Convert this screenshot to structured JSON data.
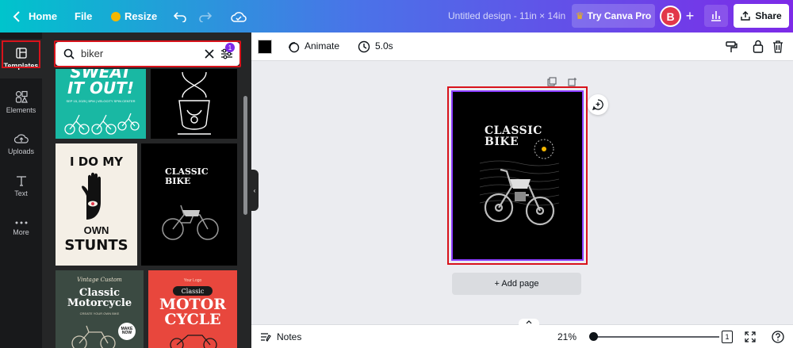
{
  "topbar": {
    "home_label": "Home",
    "file_label": "File",
    "resize_label": "Resize",
    "doc_title": "Untitled design - 11in × 14in",
    "try_pro_label": "Try Canva Pro",
    "avatar_initial": "B",
    "share_label": "Share"
  },
  "sidebar": {
    "items": [
      {
        "label": "Templates",
        "icon": "templates-icon"
      },
      {
        "label": "Elements",
        "icon": "elements-icon"
      },
      {
        "label": "Uploads",
        "icon": "uploads-icon"
      },
      {
        "label": "Text",
        "icon": "text-icon"
      },
      {
        "label": "More",
        "icon": "more-icon"
      }
    ]
  },
  "search": {
    "value": "biker",
    "filter_count": "1"
  },
  "templates": [
    {
      "name": "sweat-it-out",
      "lines": [
        "SWEAT",
        "IT OUT!"
      ],
      "meta": "SEP 15, 2025 | 5PM | VELOCITY SPIN CENTER",
      "bg": "#19b8a3"
    },
    {
      "name": "hourglass",
      "bg": "#000000"
    },
    {
      "name": "i-do-my-own-stunts",
      "lines": [
        "I DO MY",
        "OWN",
        "STUNTS"
      ],
      "bg": "#f4efe6"
    },
    {
      "name": "classic-bike-thumb",
      "lines": [
        "CLASSIC",
        "BIKE"
      ],
      "bg": "#000000"
    },
    {
      "name": "classic-motorcycle",
      "lines": [
        "Vintage Custom",
        "Classic",
        "Motorcycle",
        "CREATE YOUR OWN BIKE",
        "MAKE NOW"
      ],
      "bg": "#3b4a42"
    },
    {
      "name": "motor-cycle",
      "lines": [
        "Your Logo",
        "Classic",
        "MOTOR",
        "CYCLE"
      ],
      "bg": "#e8473d"
    }
  ],
  "toolbar": {
    "animate_label": "Animate",
    "duration": "5.0s",
    "color_swatch": "#000000"
  },
  "canvas": {
    "title_line1": "CLASSIC",
    "title_line2": "BIKE",
    "add_page_label": "+ Add page"
  },
  "bottombar": {
    "notes_label": "Notes",
    "zoom": "21%",
    "page_count": "1"
  }
}
